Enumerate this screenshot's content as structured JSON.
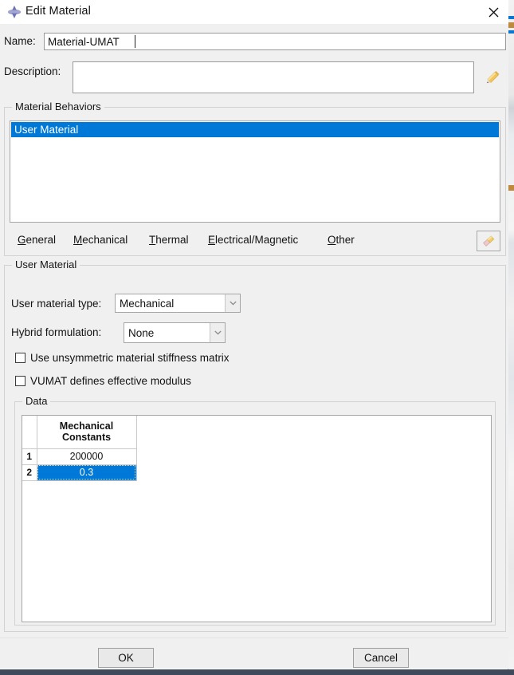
{
  "window": {
    "title": "Edit Material",
    "icon": "abaqus-diamond-icon",
    "close_icon": "close-icon",
    "accent_color": "#0078d7",
    "background_color": "#f0f0f0"
  },
  "form": {
    "name_label": "Name:",
    "name_value": "Material-UMAT",
    "description_label": "Description:",
    "description_value": "",
    "description_edit_icon": "pencil-icon"
  },
  "material_behaviors": {
    "legend": "Material Behaviors",
    "items": [
      {
        "label": "User Material",
        "selected": true
      }
    ],
    "menu": [
      {
        "label": "General",
        "mnemonic": "G"
      },
      {
        "label": "Mechanical",
        "mnemonic": "M"
      },
      {
        "label": "Thermal",
        "mnemonic": "T"
      },
      {
        "label": "Electrical/Magnetic",
        "mnemonic": "E"
      },
      {
        "label": "Other",
        "mnemonic": "O"
      }
    ],
    "delete_icon": "eraser-icon"
  },
  "user_material": {
    "legend": "User Material",
    "type_label": "User material type:",
    "type_value": "Mechanical",
    "hybrid_label": "Hybrid formulation:",
    "hybrid_value": "None",
    "unsymmetric_label": "Use unsymmetric material stiffness matrix",
    "unsymmetric_checked": false,
    "vumat_label": "VUMAT defines effective modulus",
    "vumat_checked": false
  },
  "data": {
    "legend": "Data",
    "columns": [
      "Mechanical Constants"
    ],
    "column_lines": [
      [
        "Mechanical",
        "Constants"
      ]
    ],
    "rows": [
      {
        "index": "1",
        "values": [
          "200000"
        ],
        "selected": false
      },
      {
        "index": "2",
        "values": [
          "0.3"
        ],
        "selected": true
      }
    ]
  },
  "buttons": {
    "ok": "OK",
    "cancel": "Cancel"
  }
}
